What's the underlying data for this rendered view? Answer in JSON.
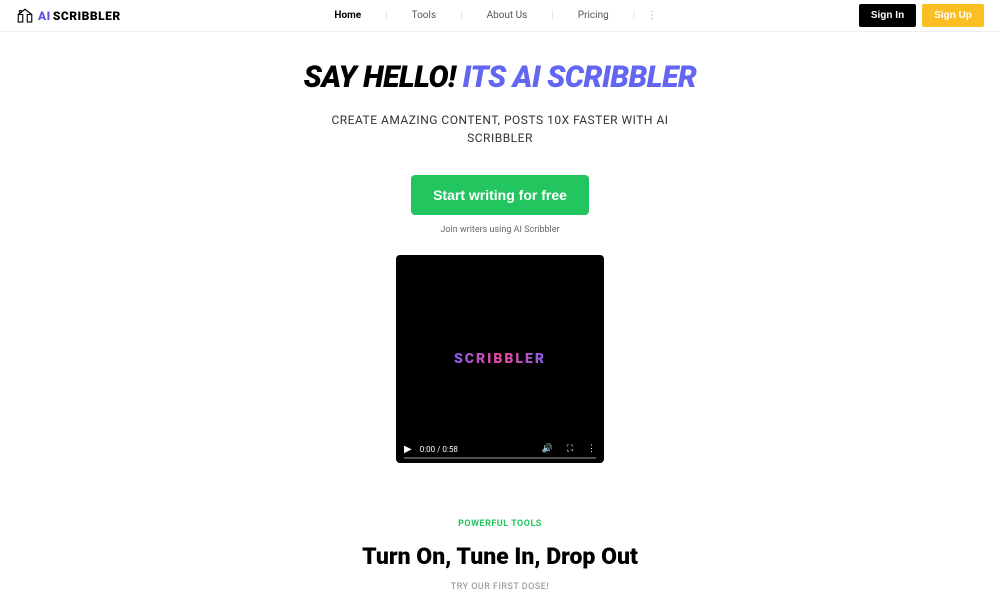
{
  "logo": {
    "ai": "AI",
    "scribbler": "SCRIBBLER"
  },
  "nav": {
    "items": [
      {
        "label": "Home",
        "active": true
      },
      {
        "label": "Tools",
        "active": false
      },
      {
        "label": "About Us",
        "active": false
      },
      {
        "label": "Pricing",
        "active": false
      }
    ]
  },
  "auth": {
    "signin": "Sign In",
    "signup": "Sign Up"
  },
  "hero": {
    "title_part1": "SAY HELLO! ",
    "title_part2": "ITS AI SCRIBBLER",
    "subtitle": "CREATE AMAZING CONTENT, POSTS 10X FASTER WITH AI SCRIBBLER",
    "cta": "Start writing for free",
    "caption": "Join writers using AI Scribbler"
  },
  "video": {
    "logo": "SCRIBBLER",
    "time_current": "0:00",
    "time_total": "0:58"
  },
  "tools": {
    "label": "POWERFUL TOOLS",
    "title": "Turn On, Tune In, Drop Out",
    "subtitle": "TRY OUR FIRST DOSE!"
  }
}
